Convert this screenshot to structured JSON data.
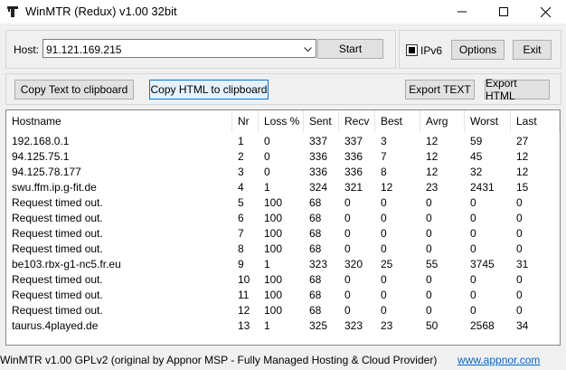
{
  "window": {
    "title": "WinMTR (Redux) v1.00 32bit"
  },
  "host": {
    "label": "Host:",
    "value": "91.121.169.215",
    "start_label": "Start"
  },
  "options": {
    "ipv6_label": "IPv6",
    "ipv6_checked": true,
    "options_label": "Options",
    "exit_label": "Exit"
  },
  "toolbar": {
    "copy_text_label": "Copy Text to clipboard",
    "copy_html_label": "Copy HTML to clipboard",
    "export_text_label": "Export TEXT",
    "export_html_label": "Export HTML"
  },
  "table": {
    "columns": [
      "Hostname",
      "Nr",
      "Loss %",
      "Sent",
      "Recv",
      "Best",
      "Avrg",
      "Worst",
      "Last"
    ],
    "rows": [
      [
        "192.168.0.1",
        "1",
        "0",
        "337",
        "337",
        "3",
        "12",
        "59",
        "27"
      ],
      [
        "94.125.75.1",
        "2",
        "0",
        "336",
        "336",
        "7",
        "12",
        "45",
        "12"
      ],
      [
        "94.125.78.177",
        "3",
        "0",
        "336",
        "336",
        "8",
        "12",
        "32",
        "12"
      ],
      [
        "swu.ffm.ip.g-fit.de",
        "4",
        "1",
        "324",
        "321",
        "12",
        "23",
        "2431",
        "15"
      ],
      [
        "Request timed out.",
        "5",
        "100",
        "68",
        "0",
        "0",
        "0",
        "0",
        "0"
      ],
      [
        "Request timed out.",
        "6",
        "100",
        "68",
        "0",
        "0",
        "0",
        "0",
        "0"
      ],
      [
        "Request timed out.",
        "7",
        "100",
        "68",
        "0",
        "0",
        "0",
        "0",
        "0"
      ],
      [
        "Request timed out.",
        "8",
        "100",
        "68",
        "0",
        "0",
        "0",
        "0",
        "0"
      ],
      [
        "be103.rbx-g1-nc5.fr.eu",
        "9",
        "1",
        "323",
        "320",
        "25",
        "55",
        "3745",
        "31"
      ],
      [
        "Request timed out.",
        "10",
        "100",
        "68",
        "0",
        "0",
        "0",
        "0",
        "0"
      ],
      [
        "Request timed out.",
        "11",
        "100",
        "68",
        "0",
        "0",
        "0",
        "0",
        "0"
      ],
      [
        "Request timed out.",
        "12",
        "100",
        "68",
        "0",
        "0",
        "0",
        "0",
        "0"
      ],
      [
        "taurus.4played.de",
        "13",
        "1",
        "325",
        "323",
        "23",
        "50",
        "2568",
        "34"
      ]
    ]
  },
  "status": {
    "text": "WinMTR v1.00 GPLv2 (original by Appnor MSP - Fully Managed Hosting & Cloud Provider)",
    "link": "www.appnor.com"
  },
  "colors": {
    "link": "#0066cc",
    "focus": "#0078d7"
  },
  "icons": {
    "app": "winmtr-app-icon",
    "minimize": "minimize-icon",
    "maximize": "maximize-icon",
    "close": "close-icon",
    "dropdown": "chevron-down-icon"
  }
}
